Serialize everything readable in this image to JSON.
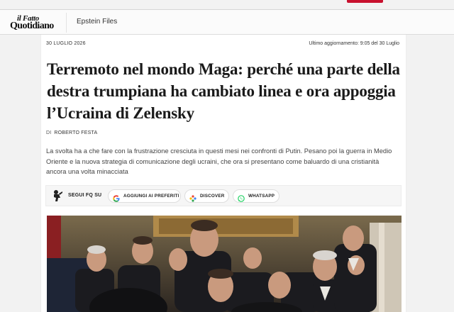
{
  "header": {
    "logo_line1": "il Fatto",
    "logo_line2": "Quotidiano",
    "nav_link": "Epstein Files"
  },
  "article": {
    "date": "30 LUGLIO 2026",
    "updated": "Ultimo aggiornamento: 9:05 del 30 Luglio",
    "headline": "Terremoto nel mondo Maga: perché una parte della destra trumpiana ha cambiato linea e ora appoggia l’Ucraina di Zelensky",
    "byline_prefix": "DI",
    "author": "ROBERTO FESTA",
    "summary": "La svolta ha a che fare con la frustrazione cresciuta in questi mesi nei confronti di Putin. Pesano poi la guerra in Medio Oriente e la nuova strategia di comunicazione degli ucraini, che ora si presentano come baluardo di una cristianità ancora una volta minacciata"
  },
  "share": {
    "follow_label": "SEGUI FQ SU",
    "google_label": "AGGIUNGI AI PREFERITI",
    "discover_label": "DISCOVER",
    "whatsapp_label": "WHATSAPP"
  },
  "icons": {
    "fq_logo": "fq-mascot-icon",
    "google": "google-icon",
    "discover": "discover-icon",
    "whatsapp": "whatsapp-icon"
  },
  "colors": {
    "accent": "#c8102e",
    "whatsapp": "#25d366"
  }
}
